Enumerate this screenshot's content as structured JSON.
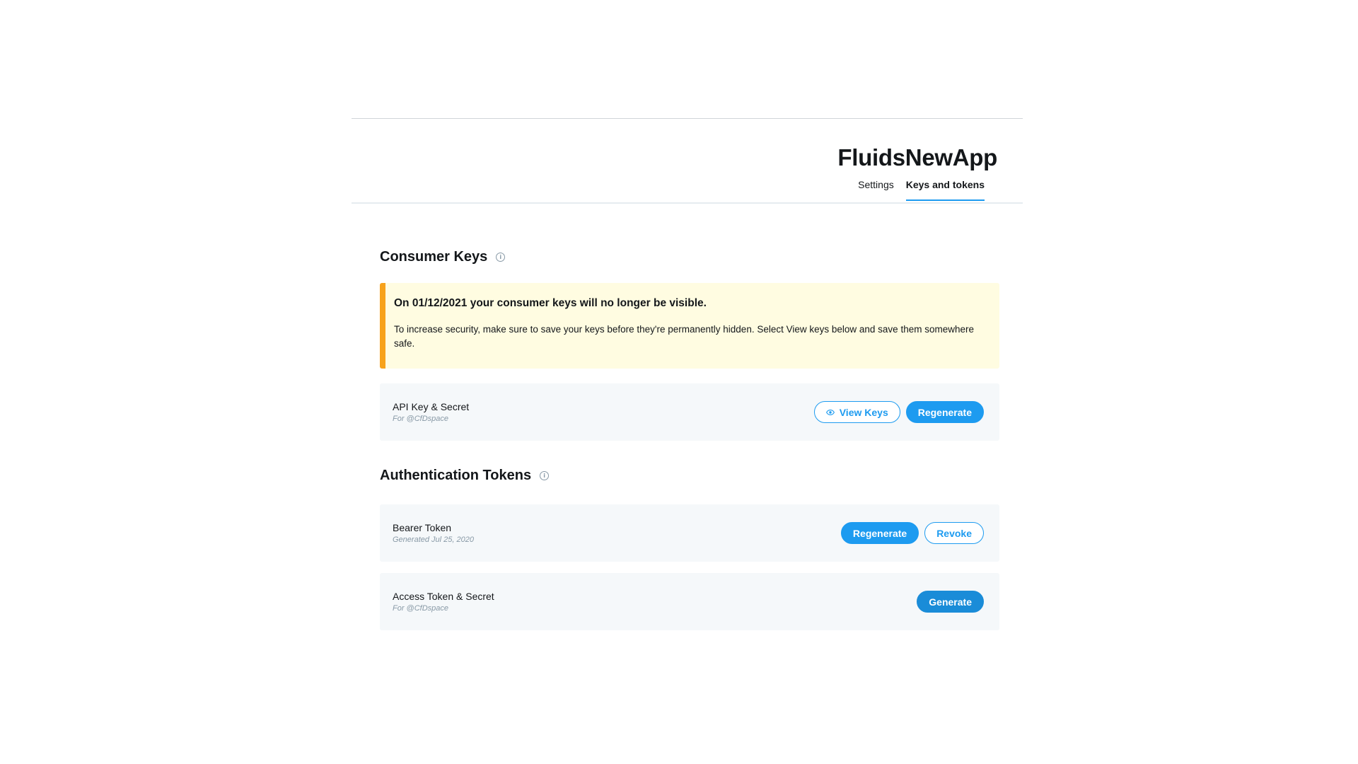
{
  "header": {
    "app_title": "FluidsNewApp",
    "tabs": [
      {
        "label": "Settings",
        "active": false
      },
      {
        "label": "Keys and tokens",
        "active": true
      }
    ]
  },
  "consumer_keys": {
    "title": "Consumer Keys",
    "alert": {
      "title": "On 01/12/2021 your consumer keys will no longer be visible.",
      "body": "To increase security, make sure to save your keys before they're permanently hidden. Select View keys below and save them somewhere safe."
    },
    "api_key": {
      "label": "API Key & Secret",
      "sub": "For @CfDspace",
      "view_keys_label": "View Keys",
      "regenerate_label": "Regenerate"
    }
  },
  "auth_tokens": {
    "title": "Authentication Tokens",
    "bearer": {
      "label": "Bearer Token",
      "sub": "Generated Jul 25, 2020",
      "regenerate_label": "Regenerate",
      "revoke_label": "Revoke"
    },
    "access": {
      "label": "Access Token & Secret",
      "sub": "For @CfDspace",
      "generate_label": "Generate"
    }
  },
  "colors": {
    "accent": "#1d9bf0",
    "warning_border": "#f7a21b",
    "warning_bg": "#fffce1",
    "card_bg": "#f5f8fa"
  }
}
